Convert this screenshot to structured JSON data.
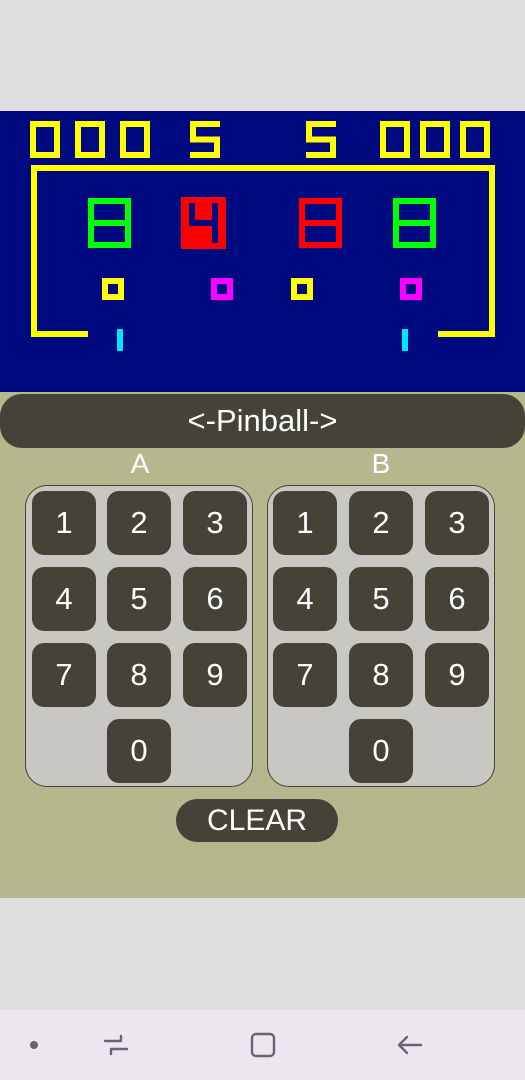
{
  "colors": {
    "screen_bg": "#000a80",
    "wall": "#ffff00",
    "score": "#ffff00",
    "bumper_green": "#00ff00",
    "bumper_red": "#ff0000",
    "target_yellow": "#ffff00",
    "target_magenta": "#ff00ff",
    "flipper_cyan": "#00e5ff",
    "panel_bg": "#b5b78c",
    "key_bg": "#454338",
    "keypad_bg": "#c9c7c2"
  },
  "game": {
    "score_a": "000",
    "ball_a": "5",
    "ball_b": "5",
    "score_b": "000",
    "bumpers": [
      {
        "digit": "8",
        "color": "green"
      },
      {
        "digit": "4",
        "color": "red"
      },
      {
        "digit": "8",
        "color": "red"
      },
      {
        "digit": "8",
        "color": "green"
      }
    ],
    "targets": [
      "yellow",
      "magenta",
      "yellow",
      "magenta"
    ]
  },
  "title": "<-Pinball->",
  "keypads": [
    {
      "label": "A",
      "keys": [
        "1",
        "2",
        "3",
        "4",
        "5",
        "6",
        "7",
        "8",
        "9",
        "0"
      ]
    },
    {
      "label": "B",
      "keys": [
        "1",
        "2",
        "3",
        "4",
        "5",
        "6",
        "7",
        "8",
        "9",
        "0"
      ]
    }
  ],
  "clear_label": "CLEAR",
  "nav": {
    "items": [
      "dot-icon",
      "recent-apps-icon",
      "home-icon",
      "back-icon"
    ]
  }
}
